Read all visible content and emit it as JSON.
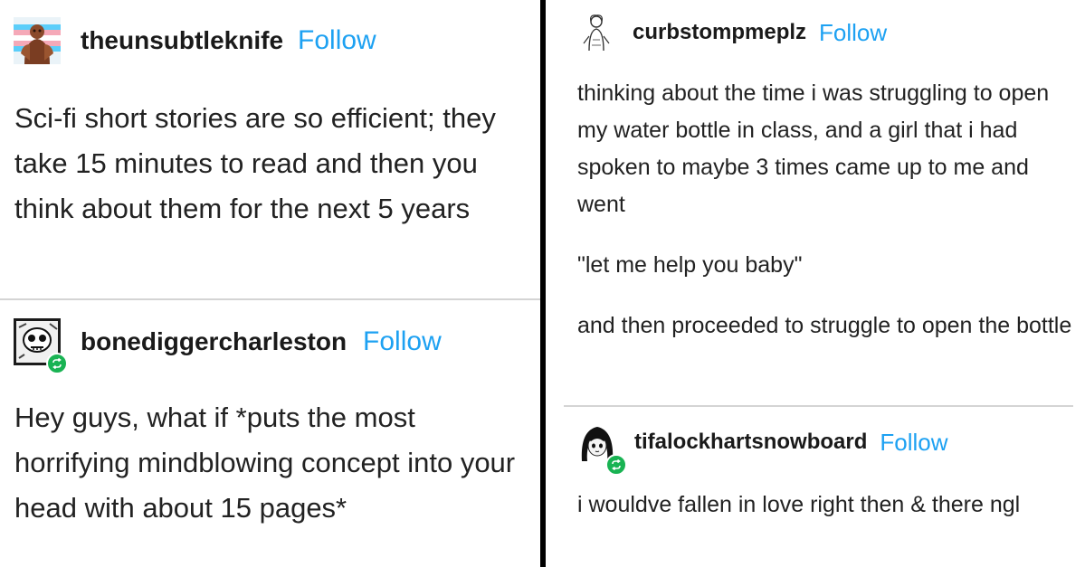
{
  "left_column": {
    "post_1": {
      "username": "theunsubtleknife",
      "follow_label": "Follow",
      "avatar_icon": "monster-figure-avatar",
      "body": "Sci-fi short stories are so efficient; they take 15 minutes to read and then you think about them for the next 5 years"
    },
    "post_2": {
      "username": "bonediggercharleston",
      "follow_label": "Follow",
      "avatar_icon": "skull-cartoon-avatar",
      "reblog_icon": "reblog-icon",
      "body": "Hey guys, what if *puts the most horrifying mindblowing concept into your head with about 15 pages*"
    }
  },
  "right_column": {
    "post_3": {
      "username": "curbstompmeplz",
      "follow_label": "Follow",
      "avatar_icon": "sketch-figure-avatar",
      "paragraphs": [
        "thinking about the time i was struggling to open my water bottle in class, and a girl that i had spoken to maybe 3 times came up to me and went",
        "\"let me help you baby\"",
        "and then proceeded to struggle to open the bottle"
      ]
    },
    "post_4": {
      "username": "tifalockhartsnowboard",
      "follow_label": "Follow",
      "avatar_icon": "anime-girl-avatar",
      "reblog_icon": "reblog-icon",
      "body": "i wouldve fallen in love right then & there ngl"
    }
  },
  "colors": {
    "follow": "#1da1f2",
    "divider": "#000000",
    "separator": "#d4d4d4",
    "reblog_badge": "#19b353",
    "text": "#222222"
  }
}
